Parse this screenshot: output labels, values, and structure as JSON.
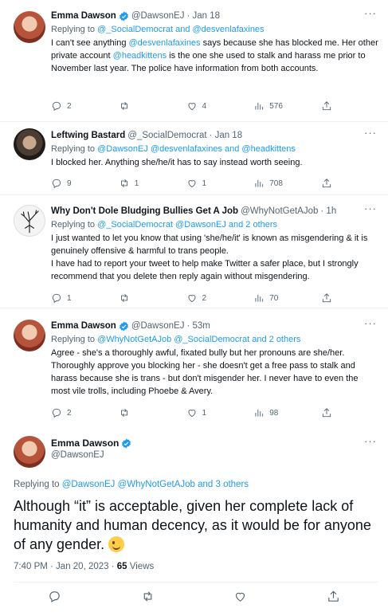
{
  "tweets": [
    {
      "name": "Emma Dawson",
      "handle": "@DawsonEJ",
      "time": "· Jan 18",
      "verified": true,
      "replying_label": "Replying to",
      "replying_to": "@_SocialDemocrat and @desvenlafaxines",
      "text_1": "I can't see anything ",
      "mention_1": "@desvenlafaxines",
      "text_2": " says because she has blocked me. Her other private account ",
      "mention_2": "@headkittens",
      "text_3": " is the one she used to stalk and harass me prior to November last year. The police have information from both accounts.",
      "replies": "2",
      "retweets": "",
      "likes": "4",
      "views": "576"
    },
    {
      "name": "Leftwing Bastard",
      "handle": "@_SocialDemocrat",
      "time": "· Jan 18",
      "verified": false,
      "replying_label": "Replying to",
      "replying_to": "@DawsonEJ @desvenlafaxines and @headkittens",
      "text": "I blocked her. Anything she/he/it has to say instead worth seeing.",
      "replies": "9",
      "retweets": "1",
      "likes": "1",
      "views": "708"
    },
    {
      "name": "Why Don't Dole Bludging Bullies Get A Job",
      "handle": "@WhyNotGetAJob",
      "time": "· 1h",
      "verified": false,
      "replying_label": "Replying to",
      "replying_to": "@_SocialDemocrat @DawsonEJ and 2 others",
      "text_1": "I just wanted to let you know that using 'she/he/it' is known as misgendering & it is genuinely offensive & harmful to trans people.",
      "text_2": "I have had to report your tweet to help make Twitter a safer place, but I strongly recommend that you delete then reply again without misgendering.",
      "replies": "1",
      "retweets": "",
      "likes": "2",
      "views": "70"
    },
    {
      "name": "Emma Dawson",
      "handle": "@DawsonEJ",
      "time": "· 53m",
      "verified": true,
      "replying_label": "Replying to",
      "replying_to": "@WhyNotGetAJob @_SocialDemocrat and 2 others",
      "text": "Agree - she's a thoroughly awful, fixated bully but her pronouns are she/her. Thoroughly approve you blocking her - she doesn't get a free pass to stalk and harass because she is trans - but don't misgender her. I never have to even the most vile trolls, including Phoebe & Avery.",
      "replies": "2",
      "retweets": "",
      "likes": "1",
      "views": "98"
    }
  ],
  "focus": {
    "name": "Emma Dawson",
    "handle": "@DawsonEJ",
    "verified": true,
    "replying_label": "Replying to",
    "replying_to": "@DawsonEJ @WhyNotGetAJob and 3 others",
    "text": "Although “it” is acceptable, given her complete lack of humanity and human decency, as it would be for anyone of any gender.",
    "emoji": "winking-face",
    "time": "7:40 PM · Jan 20, 2023 ·",
    "views_count": "65",
    "views_label": "Views"
  },
  "colors": {
    "accent": "#1d9bf0",
    "muted": "#536471",
    "text": "#0f1419",
    "border": "#eff3f4"
  },
  "more_label": "···"
}
